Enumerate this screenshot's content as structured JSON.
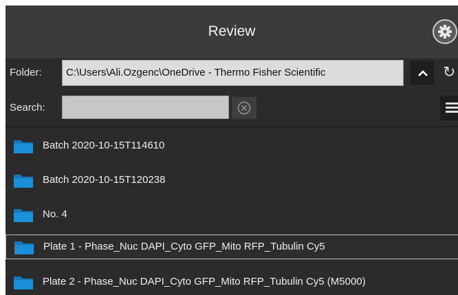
{
  "header": {
    "title": "Review"
  },
  "folder": {
    "label": "Folder:",
    "path": "C:\\Users\\Ali.Ozgenc\\OneDrive - Thermo Fisher Scientific"
  },
  "search": {
    "label": "Search:",
    "value": ""
  },
  "items": [
    {
      "label": "Batch 2020-10-15T114610",
      "selected": false
    },
    {
      "label": "Batch 2020-10-15T120238",
      "selected": false
    },
    {
      "label": "No. 4",
      "selected": false
    },
    {
      "label": "Plate 1 - Phase_Nuc DAPI_Cyto GFP_Mito RFP_Tubulin Cy5",
      "selected": true
    },
    {
      "label": "Plate 2 - Phase_Nuc DAPI_Cyto GFP_Mito RFP_Tubulin Cy5 (M5000)",
      "selected": false
    }
  ],
  "icons": {
    "settings": "gear-icon",
    "navigate_up": "chevron-up-icon",
    "refresh": "refresh-icon",
    "clear_search": "clear-circle-icon",
    "menu": "hamburger-menu-icon",
    "folder": "folder-icon"
  },
  "colors": {
    "background": "#2b2b2b",
    "header": "#3b3b3b",
    "folder_icon": "#1b8fd8",
    "text": "#eeeeee"
  }
}
